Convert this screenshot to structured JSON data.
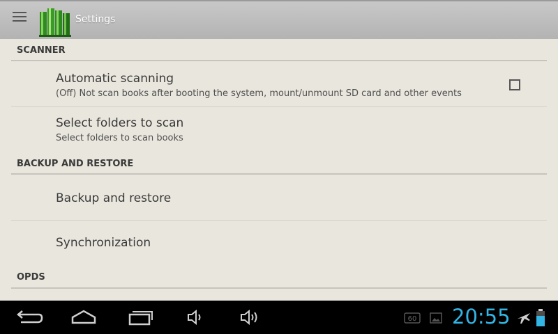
{
  "app": {
    "title": "Settings"
  },
  "icons": {
    "menu": "menu-icon",
    "logo": "books-icon"
  },
  "sections": [
    {
      "label": "SCANNER"
    },
    {
      "label": "BACKUP AND RESTORE"
    },
    {
      "label": "OPDS"
    }
  ],
  "items": [
    {
      "title": "Automatic scanning",
      "subtitle": "(Off) Not scan books after booting the system, mount/unmount SD card and other events",
      "checked": false
    },
    {
      "title": "Select folders to scan",
      "subtitle": "Select folders to scan books"
    },
    {
      "title": "Backup and restore"
    },
    {
      "title": "Synchronization"
    }
  ],
  "statusbar": {
    "time": "20:55",
    "fps_badge": "60",
    "accent_color": "#33b5e5"
  },
  "navbar": {
    "buttons": [
      "back-icon",
      "home-icon",
      "recent-apps-icon",
      "volume-down-icon",
      "volume-up-icon"
    ]
  }
}
